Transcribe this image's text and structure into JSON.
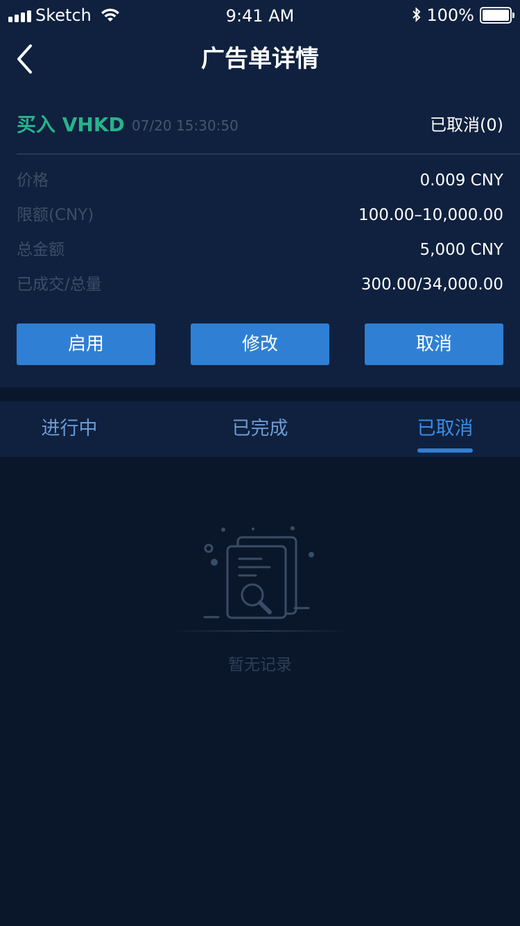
{
  "status_bar": {
    "carrier": "Sketch",
    "time": "9:41 AM",
    "battery_pct": "100%"
  },
  "nav": {
    "title": "广告单详情"
  },
  "order": {
    "type": "买入 VHKD",
    "time": "07/20 15:30:50",
    "status": "已取消(0)",
    "rows": [
      {
        "label": "价格",
        "value": "0.009 CNY"
      },
      {
        "label": "限额(CNY)",
        "value": "100.00–10,000.00"
      },
      {
        "label": "总金额",
        "value": "5,000 CNY"
      },
      {
        "label": "已成交/总量",
        "value": "300.00/34,000.00"
      }
    ]
  },
  "actions": {
    "enable": "启用",
    "modify": "修改",
    "cancel": "取消"
  },
  "tabs": [
    {
      "label": "进行中"
    },
    {
      "label": "已完成"
    },
    {
      "label": "已取消"
    }
  ],
  "active_tab": "已取消",
  "empty": {
    "text": "暂无记录",
    "icon": "empty-document-search-icon"
  },
  "colors": {
    "background": "#0a172b",
    "panel": "#0f213e",
    "accent_blue": "#2f80d4",
    "buy_green": "#27b38d"
  }
}
